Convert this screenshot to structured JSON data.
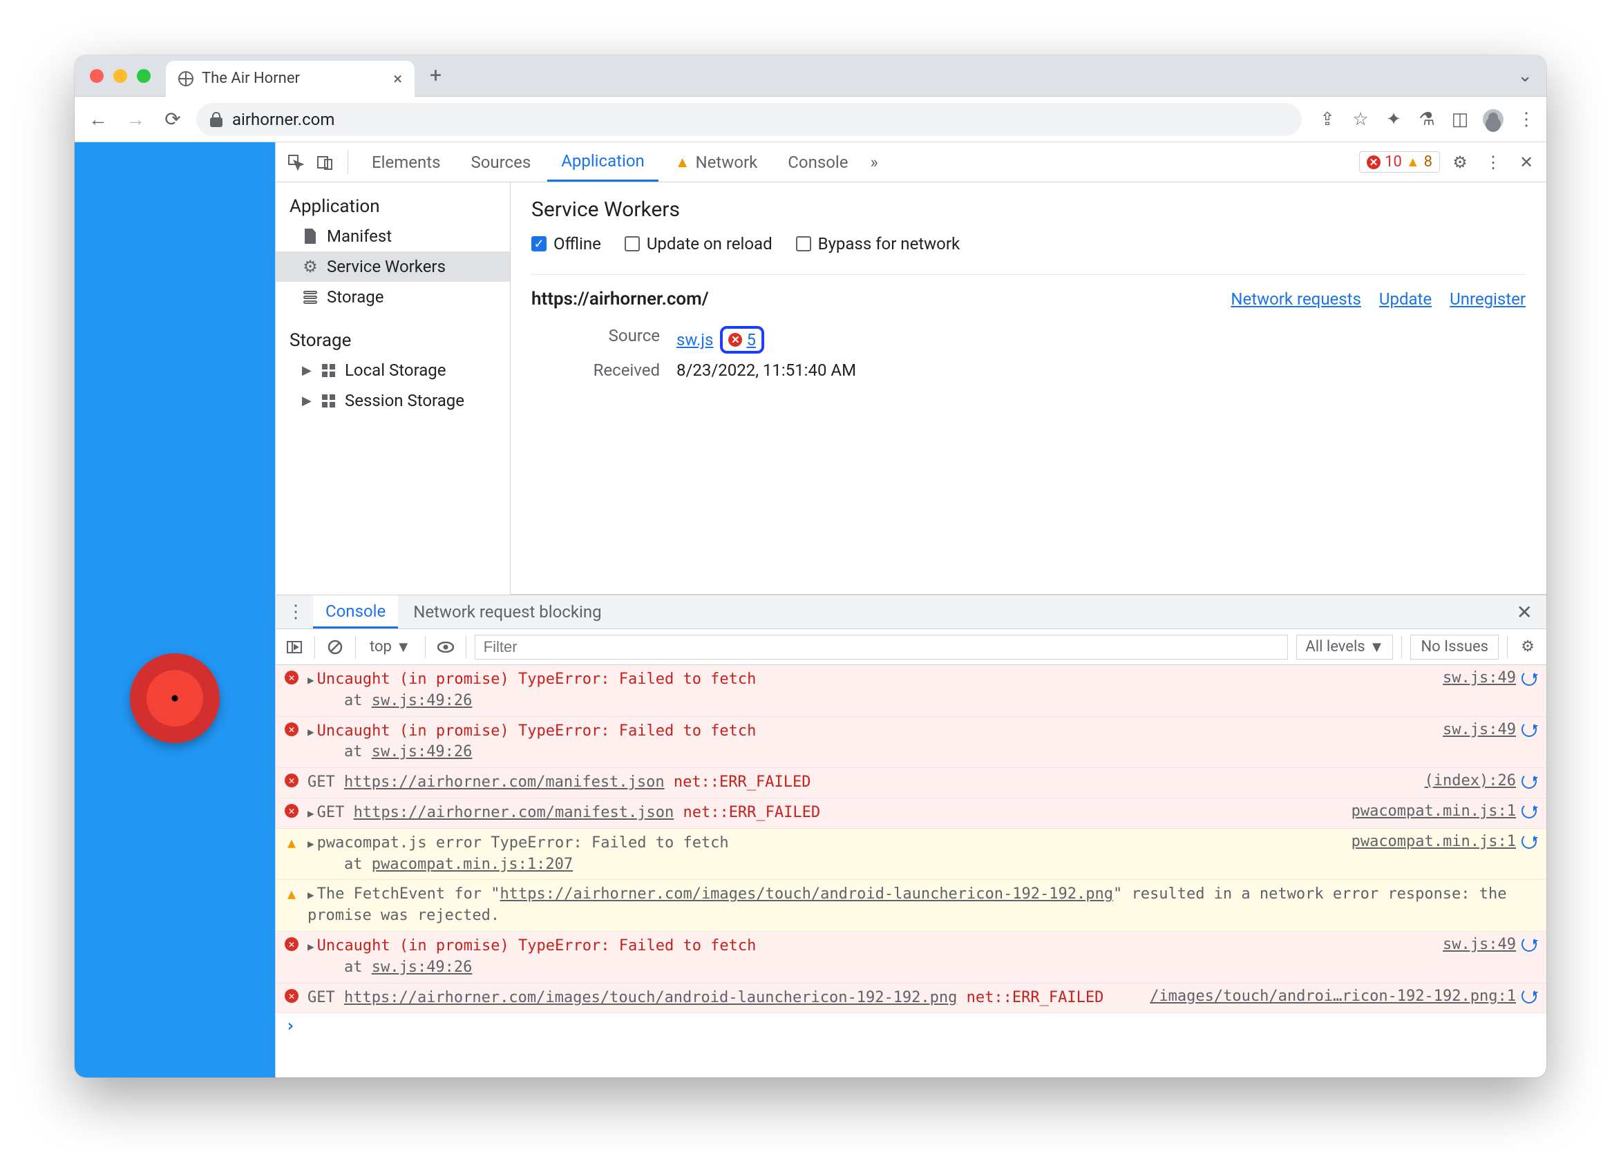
{
  "window": {
    "tab_title": "The Air Horner",
    "url": "airhorner.com"
  },
  "devtools": {
    "tabs": [
      "Elements",
      "Sources",
      "Application",
      "Network",
      "Console"
    ],
    "active_tab": "Application",
    "network_has_warning": true,
    "counts": {
      "errors": "10",
      "warnings": "8"
    }
  },
  "app_sidebar": {
    "section1": "Application",
    "items1": [
      "Manifest",
      "Service Workers",
      "Storage"
    ],
    "selected": "Service Workers",
    "section2": "Storage",
    "items2": [
      "Local Storage",
      "Session Storage"
    ]
  },
  "service_workers": {
    "heading": "Service Workers",
    "checks": {
      "offline": "Offline",
      "update": "Update on reload",
      "bypass": "Bypass for network"
    },
    "origin": "https://airhorner.com/",
    "links": {
      "network_requests": "Network requests",
      "update": "Update",
      "unregister": "Unregister"
    },
    "source_label": "Source",
    "source_file": "sw.js",
    "source_error_count": "5",
    "received_label": "Received",
    "received_value": "8/23/2022, 11:51:40 AM"
  },
  "drawer": {
    "tabs": [
      "Console",
      "Network request blocking"
    ],
    "active": "Console"
  },
  "console_toolbar": {
    "context": "top",
    "filter_placeholder": "Filter",
    "levels": "All levels",
    "no_issues": "No Issues"
  },
  "console": [
    {
      "type": "err",
      "expand": true,
      "lines": [
        "Uncaught (in promise) TypeError: Failed to fetch",
        "    at sw.js:49:26"
      ],
      "link_in_line": "sw.js:49:26",
      "source": "sw.js:49"
    },
    {
      "type": "err",
      "expand": true,
      "lines": [
        "Uncaught (in promise) TypeError: Failed to fetch",
        "    at sw.js:49:26"
      ],
      "link_in_line": "sw.js:49:26",
      "source": "sw.js:49"
    },
    {
      "type": "err",
      "expand": false,
      "prefix": "GET ",
      "url": "https://airhorner.com/manifest.json",
      "suffix": " net::ERR_FAILED",
      "source": "(index):26"
    },
    {
      "type": "err",
      "expand": true,
      "prefix": "GET ",
      "url": "https://airhorner.com/manifest.json",
      "suffix": " net::ERR_FAILED",
      "source": "pwacompat.min.js:1"
    },
    {
      "type": "warn",
      "expand": true,
      "lines": [
        "pwacompat.js error TypeError: Failed to fetch",
        "    at pwacompat.min.js:1:207"
      ],
      "link_in_line": "pwacompat.min.js:1:207",
      "source": "pwacompat.min.js:1"
    },
    {
      "type": "warn",
      "expand": true,
      "text_parts": [
        "The FetchEvent for \"",
        "https://airhorner.com/images/touch/android-launchericon-192-192.png",
        "\" resulted in a network error response: the promise was rejected."
      ],
      "source": ""
    },
    {
      "type": "err",
      "expand": true,
      "lines": [
        "Uncaught (in promise) TypeError: Failed to fetch",
        "    at sw.js:49:26"
      ],
      "link_in_line": "sw.js:49:26",
      "source": "sw.js:49"
    },
    {
      "type": "err",
      "expand": false,
      "prefix": "GET ",
      "url": "https://airhorner.com/images/touch/android-launchericon-192-192.png",
      "suffix": " net::ERR_FAILED",
      "source": "/images/touch/androi…ricon-192-192.png:1"
    }
  ]
}
